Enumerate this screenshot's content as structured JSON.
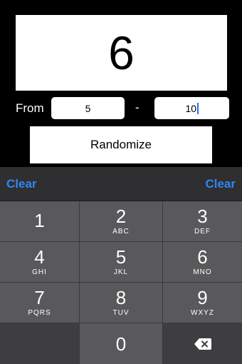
{
  "result": {
    "value": "6"
  },
  "range": {
    "from_label": "From",
    "min_value": "5",
    "separator": "-",
    "max_value": "10"
  },
  "randomize_label": "Randomize",
  "keyboard": {
    "clear_left": "Clear",
    "clear_right": "Clear",
    "keys": [
      {
        "digit": "1",
        "letters": ""
      },
      {
        "digit": "2",
        "letters": "ABC"
      },
      {
        "digit": "3",
        "letters": "DEF"
      },
      {
        "digit": "4",
        "letters": "GHI"
      },
      {
        "digit": "5",
        "letters": "JKL"
      },
      {
        "digit": "6",
        "letters": "MNO"
      },
      {
        "digit": "7",
        "letters": "PQRS"
      },
      {
        "digit": "8",
        "letters": "TUV"
      },
      {
        "digit": "9",
        "letters": "WXYZ"
      },
      {
        "digit": "0",
        "letters": ""
      }
    ],
    "backspace_icon": "backspace-icon"
  },
  "colors": {
    "accent": "#2f87f5",
    "caret": "#2a6df4",
    "key": "#59595b",
    "key_dark": "#3e3e40"
  }
}
